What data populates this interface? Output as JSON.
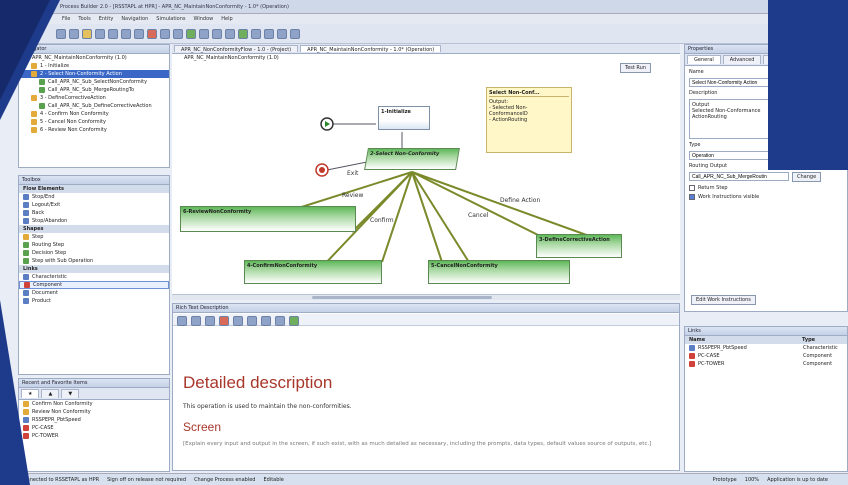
{
  "app": {
    "title": "Process Builder 2.0 - [RSSTAPL at HPR] - APR_NC_MaintainNonConformity - 1.0* (Operation)",
    "menus": [
      "File",
      "Tools",
      "Entity",
      "Navigation",
      "Simulations",
      "Window",
      "Help"
    ]
  },
  "explorer": {
    "header": "Navigator",
    "items": [
      "APR_NC_MaintainNonConformity (1.0)",
      "1 - Initialize",
      "2 - Select Non-Conformity Action",
      "Call_APR_NC_Sub_SelectNonConformity",
      "Call_APR_NC_Sub_MergeRoutingTo",
      "3 - DefineCorrectiveAction",
      "Call_APR_NC_Sub_DefineCorrectiveAction",
      "4 - Confirm Non Conformity",
      "5 - Cancel Non Conformity",
      "6 - Review Non Conformity"
    ]
  },
  "toolbox": {
    "header": "Toolbox",
    "groups": [
      {
        "label": "Flow Elements",
        "items": [
          "Stop/End",
          "Logout/Exit",
          "Back",
          "Stop/Abandon"
        ]
      },
      {
        "label": "Shapes",
        "items": [
          "Step",
          "Routing Step",
          "Decision Step",
          "Step with Sub Operation"
        ]
      },
      {
        "label": "Links",
        "items": [
          "Characteristic",
          "Component",
          "Document",
          "Product"
        ]
      }
    ],
    "selected": "Component"
  },
  "favorites": {
    "header": "Recent and Favorite Items",
    "items": [
      "Confirm Non Conformity",
      "Review Non Conformity",
      "RSSPEPR_PbtSpeed",
      "PC-CASE",
      "PC-TOWER"
    ]
  },
  "editor": {
    "tabs": [
      "APR_NC_NonConformityFlow - 1.0 - (Project)",
      "APR_NC_MaintainNonConformity - 1.0* (Operation)"
    ],
    "breadcrumb": "APR_NC_MaintainNonConformity (1.0)",
    "test_run": "Test Run",
    "nodes": {
      "init": "1-Initialize",
      "select": "2-Select Non-Conformity",
      "review": "6-ReviewNonConformity",
      "define": "3-DefineCorrectiveAction",
      "confirm": "4-ConfirmNonConformity",
      "cancel": "5-CancelNonConformity"
    },
    "links": {
      "exit": "Exit",
      "review": "Review",
      "confirm": "Confirm",
      "cancel": "Cancel",
      "define": "Define Action"
    },
    "note": {
      "title": "Select Non-Conf...",
      "body": [
        "Output:",
        "- Selected Non-",
        "ConformanceID",
        "- ActionRouting"
      ]
    }
  },
  "description": {
    "header": "Rich Text Description",
    "h1": "Detailed description",
    "p1": "This operation is used to maintain the non-conformities.",
    "h2": "Screen",
    "p2": "[Explain every input and output in the screen, if such exist, with as much detailed as necessary, including the prompts, data types, default values source of outputs, etc.]"
  },
  "properties": {
    "header": "Properties",
    "tabs": [
      "General",
      "Advanced",
      "Ext"
    ],
    "name_label": "Name",
    "name_value": "Select Non-Conformity Action",
    "desc_label": "Description",
    "output_label": "Output",
    "output_lines": [
      "Selected Non-Conformance",
      "ActionRouting"
    ],
    "type_label": "Type",
    "type_value": "Operation",
    "routing_label": "Routing Output",
    "routing_value": "Call_APR_NC_Sub_MergeRoutin",
    "change_btn": "Change",
    "return_step": "Return Step",
    "work_instr": "Work Instructions visible",
    "edit_btn": "Edit Work Instructions"
  },
  "links_panel": {
    "header": "Links",
    "col_name": "Name",
    "col_type": "Type",
    "rows": [
      {
        "name": "RSSPEPR_PbtSpeed",
        "type": "Characteristic"
      },
      {
        "name": "PC-CASE",
        "type": "Component"
      },
      {
        "name": "PC-TOWER",
        "type": "Component"
      }
    ]
  },
  "status": {
    "left": "Connected to RSSETAPL as HPR",
    "sign": "Sign off on release not required",
    "change": "Change Process enabled",
    "editable": "Editable",
    "right1": "Prototype",
    "right2": "100%",
    "right3": "Application is up to date"
  }
}
